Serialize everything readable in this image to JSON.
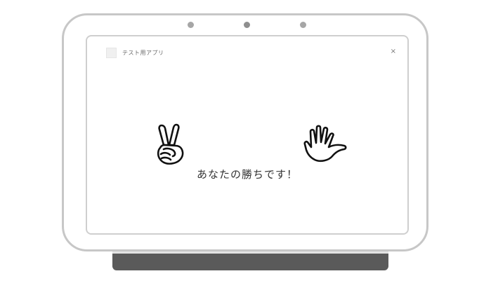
{
  "app": {
    "title": "テスト用アプリ",
    "close_label": "×"
  },
  "game": {
    "player_hand": "choki",
    "opponent_hand": "paa",
    "result_text": "あなたの勝ちです！"
  },
  "icons": {
    "player_hand_icon": "peace-hand-icon",
    "opponent_hand_icon": "open-hand-icon",
    "close_icon": "close-icon"
  },
  "colors": {
    "frame": "#c7c7c7",
    "base": "#5a5a5a",
    "text": "#333333"
  }
}
